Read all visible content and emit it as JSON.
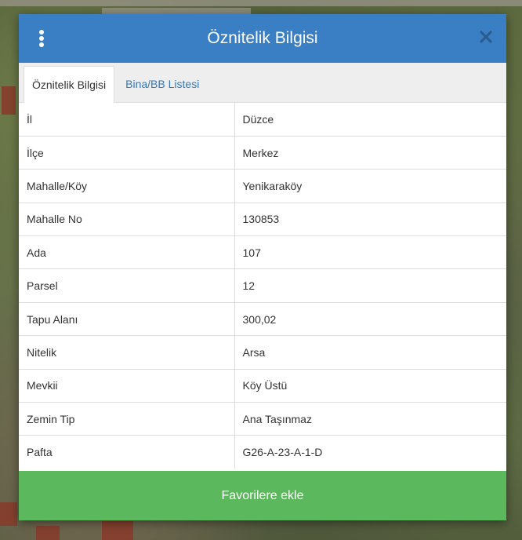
{
  "dialog": {
    "title": "Öznitelik Bilgisi",
    "menu_icon": "more-vertical-icon",
    "close_icon": "close-icon",
    "header_color": "#3a7fc3"
  },
  "tabs": [
    {
      "label": "Öznitelik Bilgisi",
      "active": true
    },
    {
      "label": "Bina/BB Listesi",
      "active": false
    }
  ],
  "attributes": [
    {
      "key": "İl",
      "value": "Düzce"
    },
    {
      "key": "İlçe",
      "value": "Merkez"
    },
    {
      "key": "Mahalle/Köy",
      "value": "Yenikaraköy"
    },
    {
      "key": "Mahalle No",
      "value": "130853"
    },
    {
      "key": "Ada",
      "value": "107"
    },
    {
      "key": "Parsel",
      "value": "12"
    },
    {
      "key": "Tapu Alanı",
      "value": "300,02"
    },
    {
      "key": "Nitelik",
      "value": "Arsa"
    },
    {
      "key": "Mevkii",
      "value": "Köy Üstü"
    },
    {
      "key": "Zemin Tip",
      "value": "Ana Taşınmaz"
    },
    {
      "key": "Pafta",
      "value": "G26-A-23-A-1-D"
    }
  ],
  "footer": {
    "favorite_label": "Favorilere ekle",
    "button_color": "#5cb85c"
  }
}
